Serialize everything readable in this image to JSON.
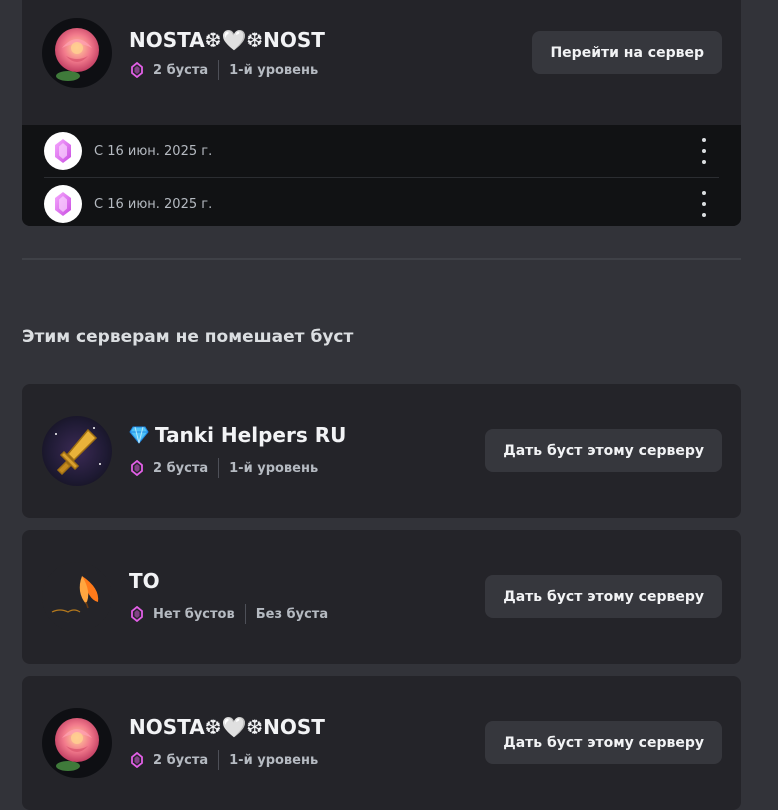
{
  "boosted_server": {
    "name": "NOSTA❆🤍❆NOST",
    "boost_count": "2 буста",
    "level": "1-й уровень",
    "action_label": "Перейти на сервер",
    "boosts": [
      {
        "date": "С 16 июн. 2025 г.",
        "icon": "boost-gem-icon"
      },
      {
        "date": "С 16 июн. 2025 г.",
        "icon": "boost-gem-icon"
      }
    ]
  },
  "section_title": "Этим серверам не помешает буст",
  "servers": [
    {
      "name": "Tanki Helpers RU",
      "prefix_icon": "diamond-icon",
      "boost_count": "2 буста",
      "level": "1-й уровень",
      "action_label": "Дать буст этому серверу"
    },
    {
      "name": "ТО",
      "boost_count": "Нет бустов",
      "level": "Без буста",
      "action_label": "Дать буст этому серверу"
    },
    {
      "name": "NOSTA❆🤍❆NOST",
      "boost_count": "2 буста",
      "level": "1-й уровень",
      "action_label": "Дать буст этому серверу"
    }
  ],
  "colors": {
    "background": "#323339",
    "card": "#242429",
    "boost_list": "#111214",
    "button": "#36373d",
    "gem": "#e25fe6"
  }
}
